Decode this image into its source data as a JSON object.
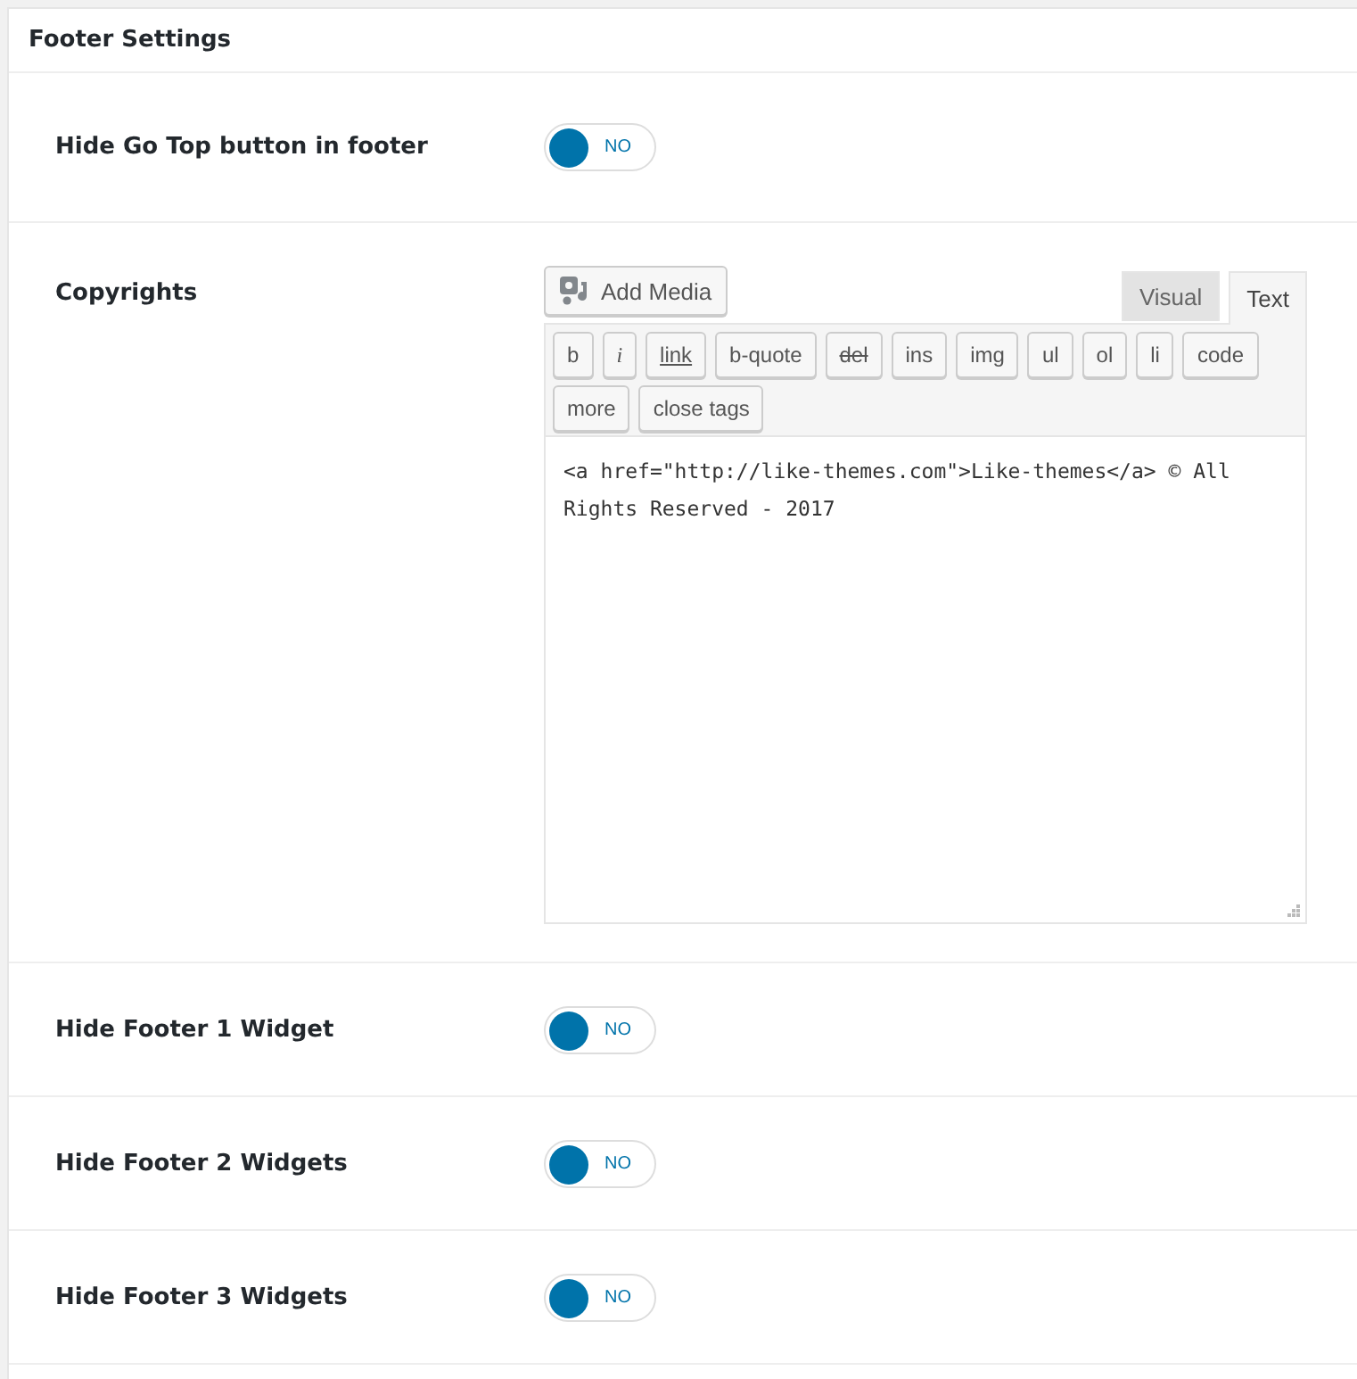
{
  "panel": {
    "title": "Footer Settings"
  },
  "settings": [
    {
      "kind": "toggle",
      "label": "Hide Go Top button in footer",
      "on": false,
      "state_text": "NO"
    },
    {
      "kind": "editor",
      "label": "Copyrights",
      "add_media": "Add Media",
      "tabs": [
        {
          "label": "Visual",
          "selected": false
        },
        {
          "label": "Text",
          "selected": true
        }
      ],
      "quicktags": [
        {
          "label": "b",
          "kind": "plain"
        },
        {
          "label": "i",
          "kind": "italic"
        },
        {
          "label": "link",
          "kind": "underline"
        },
        {
          "label": "b-quote",
          "kind": "plain"
        },
        {
          "label": "del",
          "kind": "strike"
        },
        {
          "label": "ins",
          "kind": "plain"
        },
        {
          "label": "img",
          "kind": "plain"
        },
        {
          "label": "ul",
          "kind": "plain"
        },
        {
          "label": "ol",
          "kind": "plain"
        },
        {
          "label": "li",
          "kind": "plain"
        },
        {
          "label": "code",
          "kind": "plain"
        },
        {
          "label": "more",
          "kind": "plain"
        },
        {
          "label": "close tags",
          "kind": "plain"
        }
      ],
      "value": "<a href=\"http://like-themes.com\">Like-themes</a> © All Rights Reserved - 2017"
    },
    {
      "kind": "toggle",
      "label": "Hide Footer 1 Widget",
      "on": false,
      "state_text": "NO"
    },
    {
      "kind": "toggle",
      "label": "Hide Footer 2 Widgets",
      "on": false,
      "state_text": "NO"
    },
    {
      "kind": "toggle",
      "label": "Hide Footer 3 Widgets",
      "on": false,
      "state_text": "NO"
    }
  ]
}
